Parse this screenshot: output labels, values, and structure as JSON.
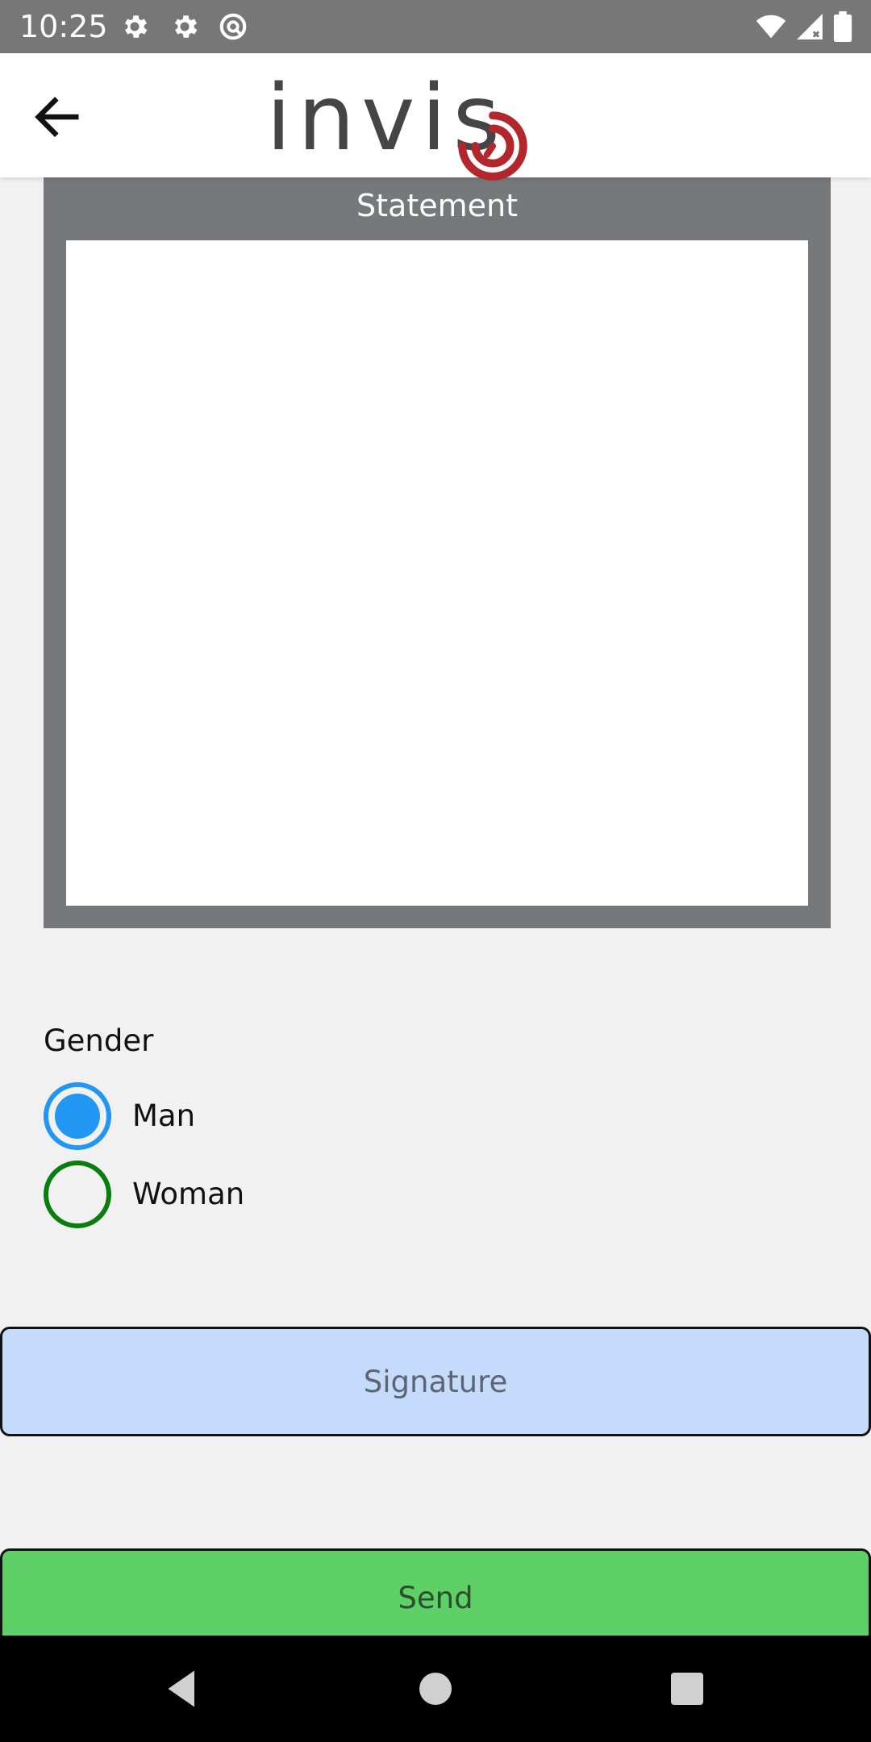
{
  "status_bar": {
    "time": "10:25",
    "icons": [
      "gear-icon",
      "gear-icon",
      "at-sign-icon",
      "wifi-icon",
      "signal-icon",
      "battery-icon"
    ]
  },
  "header": {
    "logo_text": "invis",
    "back_icon": "arrow-left-icon",
    "logo_color": "#454545",
    "logo_accent": "#b3262b"
  },
  "statement": {
    "title": "Statement",
    "value": ""
  },
  "gender": {
    "label": "Gender",
    "options": [
      {
        "label": "Man",
        "checked": true
      },
      {
        "label": "Woman",
        "checked": false
      }
    ]
  },
  "signature_button": {
    "label": "Signature",
    "color": "#c5dbfb"
  },
  "send_button": {
    "label": "Send",
    "color": "#5fcf68"
  },
  "nav_bar": {
    "icons": [
      "back-triangle-icon",
      "home-circle-icon",
      "recents-square-icon"
    ]
  },
  "colors": {
    "radio_checked": "#2196f3",
    "radio_unchecked": "#0a7d10",
    "panel": "#76787c"
  }
}
